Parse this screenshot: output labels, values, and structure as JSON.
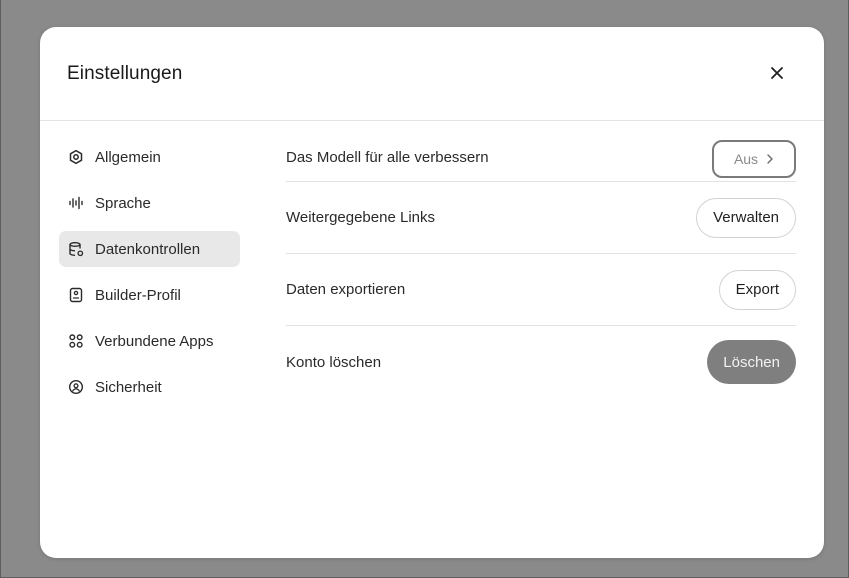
{
  "dialog": {
    "title": "Einstellungen",
    "close_icon": "close-icon"
  },
  "sidebar": {
    "items": [
      {
        "label": "Allgemein",
        "icon": "gear-icon",
        "active": false
      },
      {
        "label": "Sprache",
        "icon": "audio-wave-icon",
        "active": false
      },
      {
        "label": "Datenkontrollen",
        "icon": "database-settings-icon",
        "active": true
      },
      {
        "label": "Builder-Profil",
        "icon": "id-card-icon",
        "active": false
      },
      {
        "label": "Verbundene Apps",
        "icon": "apps-grid-icon",
        "active": false
      },
      {
        "label": "Sicherheit",
        "icon": "shield-user-icon",
        "active": false
      }
    ]
  },
  "settings": {
    "improve_model": {
      "label": "Das Modell für alle verbessern",
      "value": "Aus",
      "icon": "chevron-right-icon"
    },
    "shared_links": {
      "label": "Weitergegebene Links",
      "button": "Verwalten"
    },
    "export_data": {
      "label": "Daten exportieren",
      "button": "Export"
    },
    "delete_account": {
      "label": "Konto löschen",
      "button": "Löschen"
    }
  },
  "colors": {
    "backdrop": "#8a8a8a",
    "danger_button": "#7f7f7f",
    "active_nav": "#e8e8e8"
  }
}
